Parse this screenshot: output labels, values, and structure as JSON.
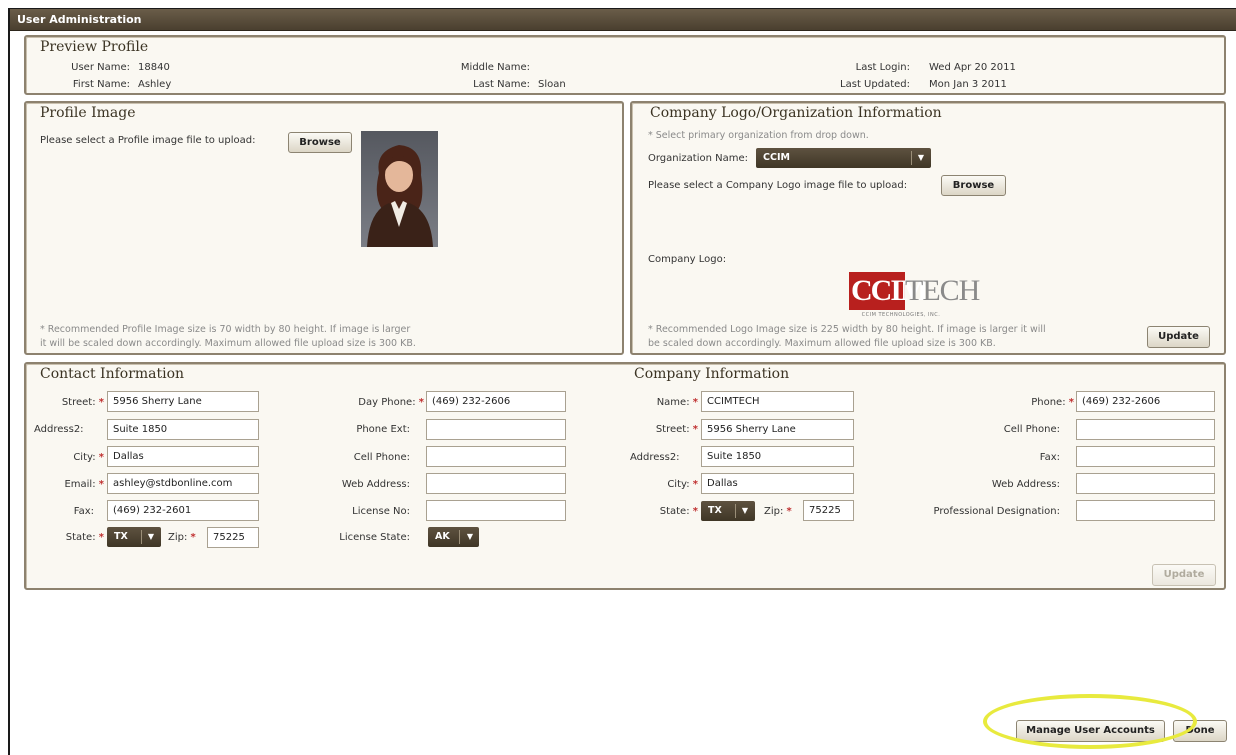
{
  "window": {
    "title": "User Administration"
  },
  "preview": {
    "title": "Preview Profile",
    "user_name_label": "User Name:",
    "user_name": "18840",
    "first_name_label": "First Name:",
    "first_name": "Ashley",
    "middle_name_label": "Middle Name:",
    "middle_name": "",
    "last_name_label": "Last Name:",
    "last_name": "Sloan",
    "last_login_label": "Last Login:",
    "last_login": "Wed Apr 20 2011",
    "last_updated_label": "Last Updated:",
    "last_updated": "Mon Jan 3 2011"
  },
  "profile_image": {
    "title": "Profile Image",
    "prompt": "Please select a Profile image file to upload:",
    "browse_label": "Browse",
    "note_line1": "* Recommended Profile Image size is 70 width by 80 height. If image is larger",
    "note_line2": "it will be scaled down accordingly. Maximum allowed file upload size is 300 KB."
  },
  "company_logo": {
    "title": "Company Logo/Organization Information",
    "hint": "* Select primary organization from drop down.",
    "org_label": "Organization Name:",
    "org_value": "CCIM",
    "prompt": "Please select a Company Logo image file to upload:",
    "browse_label": "Browse",
    "logo_label": "Company Logo:",
    "logo_text_main": "CCIM",
    "logo_text_tech": "TECH",
    "logo_subtext": "CCIM TECHNOLOGIES, INC.",
    "note_line1": "* Recommended Logo Image size is 225 width by 80 height. If image is larger it will",
    "note_line2": "be scaled down accordingly. Maximum allowed file upload size is 300 KB.",
    "update_label": "Update"
  },
  "contact": {
    "title": "Contact Information",
    "street_label": "Street:",
    "street": "5956 Sherry Lane",
    "address2_label": "Address2:",
    "address2": "Suite 1850",
    "city_label": "City:",
    "city": "Dallas",
    "email_label": "Email:",
    "email": "ashley@stdbonline.com",
    "fax_label": "Fax:",
    "fax": "(469) 232-2601",
    "state_label": "State:",
    "state": "TX",
    "zip_label": "Zip:",
    "zip": "75225",
    "day_phone_label": "Day Phone:",
    "day_phone": "(469) 232-2606",
    "phone_ext_label": "Phone Ext:",
    "phone_ext": "",
    "cell_phone_label": "Cell Phone:",
    "cell_phone": "",
    "web_address_label": "Web Address:",
    "web_address": "",
    "license_no_label": "License No:",
    "license_no": "",
    "license_state_label": "License State:",
    "license_state": "AK",
    "required_marker": "*"
  },
  "company": {
    "title": "Company Information",
    "name_label": "Name:",
    "name": "CCIMTECH",
    "street_label": "Street:",
    "street": "5956 Sherry Lane",
    "address2_label": "Address2:",
    "address2": "Suite 1850",
    "city_label": "City:",
    "city": "Dallas",
    "state_label": "State:",
    "state": "TX",
    "zip_label": "Zip:",
    "zip": "75225",
    "phone_label": "Phone:",
    "phone": "(469) 232-2606",
    "cell_phone_label": "Cell Phone:",
    "cell_phone": "",
    "fax_label": "Fax:",
    "fax": "",
    "web_address_label": "Web Address:",
    "web_address": "",
    "prof_designation_label": "Professional Designation:",
    "prof_designation": "",
    "update_label": "Update"
  },
  "footer": {
    "manage_label": "Manage User Accounts",
    "done_label": "Done"
  },
  "colors": {
    "titlebar": "#4a3f2f",
    "panel_border": "#8d826f",
    "required": "#c03030",
    "highlight": "#e8ea3e"
  }
}
